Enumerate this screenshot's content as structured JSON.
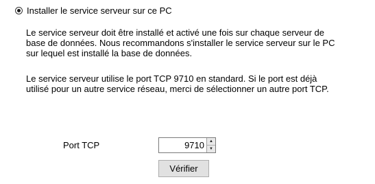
{
  "option": {
    "label": "Installer le service serveur sur ce PC",
    "selected": true
  },
  "paragraphs": {
    "p1": [
      "Le service serveur doit être installé et activé une fois sur chaque serveur de",
      "base de données. Nous recommandons s'installer le service serveur sur le PC",
      "sur lequel est installé la base de données."
    ],
    "p2": [
      "Le service serveur utilise le port TCP 9710 en standard. Si le port est déjà",
      "utilisé pour un autre service réseau, merci de sélectionner un autre port TCP."
    ]
  },
  "port": {
    "label": "Port TCP",
    "value": "9710"
  },
  "verify_button": "Vérifier",
  "icons": {
    "spin_up": "spin-up-arrow",
    "spin_down": "spin-down-arrow"
  }
}
